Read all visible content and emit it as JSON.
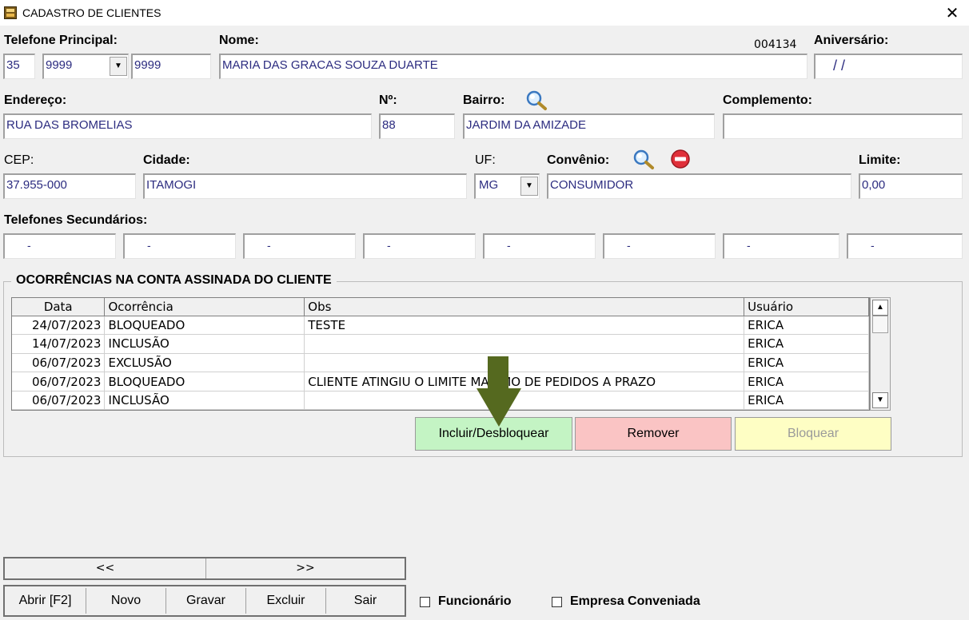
{
  "window": {
    "title": "CADASTRO DE CLIENTES",
    "close_glyph": "✕",
    "record_code": "004134"
  },
  "form": {
    "telefone_principal": {
      "label": "Telefone Principal:",
      "ddd": "35",
      "prefix": "9999",
      "suffix": "9999"
    },
    "nome": {
      "label": "Nome:",
      "value": "MARIA DAS GRACAS SOUZA DUARTE"
    },
    "aniversario": {
      "label": "Aniversário:",
      "value": "/ /"
    },
    "endereco": {
      "label": "Endereço:",
      "value": "RUA DAS BROMELIAS"
    },
    "numero": {
      "label": "Nº:",
      "value": "88"
    },
    "bairro": {
      "label": "Bairro:",
      "value": "JARDIM DA AMIZADE"
    },
    "complemento": {
      "label": "Complemento:",
      "value": ""
    },
    "cep": {
      "label": "CEP:",
      "value": "37.955-000"
    },
    "cidade": {
      "label": "Cidade:",
      "value": "ITAMOGI"
    },
    "uf": {
      "label": "UF:",
      "value": "MG"
    },
    "convenio": {
      "label": "Convênio:",
      "value": "CONSUMIDOR"
    },
    "limite": {
      "label": "Limite:",
      "value": "0,00"
    },
    "telefones_secundarios": {
      "label": "Telefones Secundários:",
      "values": [
        "-",
        "-",
        "-",
        "-",
        "-",
        "-",
        "-",
        "-"
      ]
    }
  },
  "ocorrencias": {
    "title": "OCORRÊNCIAS NA CONTA ASSINADA DO CLIENTE",
    "columns": [
      "Data",
      "Ocorrência",
      "Obs",
      "Usuário"
    ],
    "rows": [
      [
        "24/07/2023",
        "BLOQUEADO",
        "TESTE",
        "ERICA"
      ],
      [
        "14/07/2023",
        "INCLUSÃO",
        "",
        "ERICA"
      ],
      [
        "06/07/2023",
        "EXCLUSÃO",
        "",
        "ERICA"
      ],
      [
        "06/07/2023",
        "BLOQUEADO",
        "CLIENTE ATINGIU O LIMITE MAXIMO DE PEDIDOS A PRAZO",
        "ERICA"
      ],
      [
        "06/07/2023",
        "INCLUSÃO",
        "",
        "ERICA"
      ]
    ],
    "buttons": {
      "incluir": "Incluir/Desbloquear",
      "remover": "Remover",
      "bloquear": "Bloquear"
    }
  },
  "navigation": {
    "prev": "<<",
    "next": ">>"
  },
  "toolbar": {
    "abrir": "Abrir [F2]",
    "novo": "Novo",
    "gravar": "Gravar",
    "excluir": "Excluir",
    "sair": "Sair"
  },
  "checkboxes": {
    "funcionario": "Funcionário",
    "empresa_conveniada": "Empresa Conveniada"
  },
  "colors": {
    "incluir_bg": "#c4f4c4",
    "remover_bg": "#fac4c4",
    "bloquear_bg": "#fefec4",
    "field_text": "#2c2c80",
    "arrow": "#55691f"
  },
  "icons": {
    "app": "cash-register-icon",
    "search": "magnifier-icon",
    "remove": "stop-icon",
    "annotation": "down-arrow-icon"
  }
}
